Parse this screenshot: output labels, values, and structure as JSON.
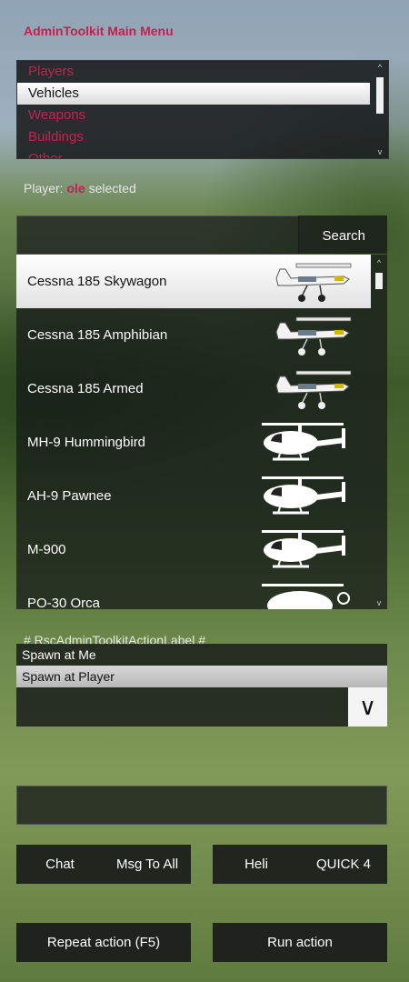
{
  "title": "AdminToolkit Main Menu",
  "menu": {
    "items": [
      "Players",
      "Vehicles",
      "Weapons",
      "Buildings",
      "Other"
    ],
    "selected_index": 1
  },
  "player_status": {
    "prefix": "Player:",
    "name": "ole",
    "suffix": "selected"
  },
  "search": {
    "value": "",
    "button_label": "Search"
  },
  "vehicles": {
    "items": [
      {
        "label": "Cessna 185 Skywagon",
        "icon": "plane-icon"
      },
      {
        "label": "Cessna 185 Amphibian",
        "icon": "plane-icon"
      },
      {
        "label": "Cessna 185 Armed",
        "icon": "plane-icon"
      },
      {
        "label": "MH-9 Hummingbird",
        "icon": "helicopter-icon"
      },
      {
        "label": "AH-9 Pawnee",
        "icon": "helicopter-icon"
      },
      {
        "label": "M-900",
        "icon": "helicopter-icon"
      },
      {
        "label": "PO-30 Orca",
        "icon": "helicopter-icon"
      }
    ],
    "selected_index": 0
  },
  "action": {
    "label": "# RscAdminToolkitActionLabel #",
    "options": [
      "Spawn at Me",
      "Spawn at Player"
    ],
    "selected_index": 1,
    "combo_value": ""
  },
  "text_field": {
    "value": ""
  },
  "buttons": {
    "chat": "Chat",
    "msg_to_all": "Msg To All",
    "heli": "Heli",
    "quick4": "QUICK 4",
    "repeat": "Repeat action (F5)",
    "run": "Run action"
  },
  "colors": {
    "accent": "#c4214e",
    "selected_bg": "#ffffff",
    "panel_bg": "#141618"
  }
}
